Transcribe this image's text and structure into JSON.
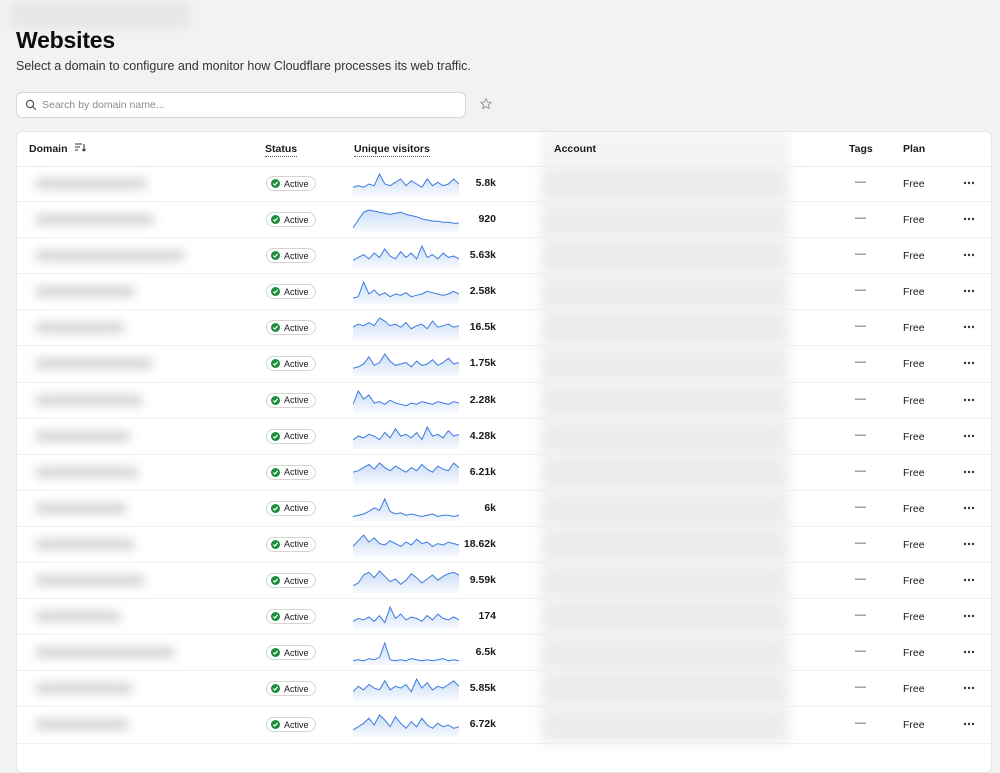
{
  "page": {
    "title": "Websites",
    "subtitle": "Select a domain to configure and monitor how Cloudflare processes its web traffic."
  },
  "search": {
    "placeholder": "Search by domain name..."
  },
  "colors": {
    "accent": "#3b7be0",
    "spark_fill": "#c9dbf5",
    "status_green": "#1a8f3a"
  },
  "table": {
    "headers": {
      "domain": "Domain",
      "status": "Status",
      "visitors": "Unique visitors",
      "account": "Account",
      "tags": "Tags",
      "plan": "Plan"
    },
    "rows": [
      {
        "status": "Active",
        "visitors": "5.8k",
        "tags": "—",
        "plan": "Free",
        "spark": [
          4,
          5,
          4,
          6,
          5,
          12,
          6,
          5,
          7,
          9,
          5,
          8,
          6,
          4,
          9,
          5,
          7,
          5,
          6,
          9,
          6
        ]
      },
      {
        "status": "Active",
        "visitors": "920",
        "tags": "—",
        "plan": "Free",
        "spark": [
          2,
          9,
          16,
          18,
          17,
          16,
          15,
          14,
          15,
          16,
          14,
          13,
          12,
          10,
          9,
          8,
          8,
          7,
          7,
          6,
          6
        ]
      },
      {
        "status": "Active",
        "visitors": "5.63k",
        "tags": "—",
        "plan": "Free",
        "spark": [
          4,
          6,
          8,
          5,
          9,
          6,
          12,
          7,
          5,
          10,
          6,
          9,
          5,
          14,
          6,
          8,
          5,
          9,
          6,
          7,
          5
        ]
      },
      {
        "status": "Active",
        "visitors": "2.58k",
        "tags": "—",
        "plan": "Free",
        "spark": [
          3,
          4,
          15,
          6,
          9,
          5,
          7,
          4,
          6,
          5,
          7,
          4,
          5,
          6,
          8,
          7,
          6,
          5,
          6,
          8,
          6
        ]
      },
      {
        "status": "Active",
        "visitors": "16.5k",
        "tags": "—",
        "plan": "Free",
        "spark": [
          7,
          9,
          8,
          10,
          8,
          13,
          11,
          8,
          9,
          7,
          10,
          6,
          8,
          9,
          6,
          11,
          7,
          8,
          9,
          7,
          8
        ]
      },
      {
        "status": "Active",
        "visitors": "1.75k",
        "tags": "—",
        "plan": "Free",
        "spark": [
          4,
          5,
          7,
          12,
          6,
          8,
          14,
          9,
          6,
          7,
          8,
          5,
          9,
          6,
          7,
          10,
          6,
          8,
          11,
          7,
          8
        ]
      },
      {
        "status": "Active",
        "visitors": "2.28k",
        "tags": "—",
        "plan": "Free",
        "spark": [
          5,
          15,
          9,
          12,
          6,
          7,
          5,
          8,
          6,
          5,
          4,
          6,
          5,
          7,
          6,
          5,
          7,
          6,
          5,
          7,
          6
        ]
      },
      {
        "status": "Active",
        "visitors": "4.28k",
        "tags": "—",
        "plan": "Free",
        "spark": [
          4,
          6,
          5,
          7,
          6,
          4,
          8,
          5,
          10,
          6,
          7,
          5,
          8,
          4,
          11,
          6,
          7,
          5,
          9,
          6,
          7
        ]
      },
      {
        "status": "Active",
        "visitors": "6.21k",
        "tags": "—",
        "plan": "Free",
        "spark": [
          7,
          8,
          10,
          12,
          9,
          13,
          10,
          8,
          11,
          9,
          7,
          10,
          8,
          12,
          9,
          7,
          11,
          9,
          8,
          13,
          10
        ]
      },
      {
        "status": "Active",
        "visitors": "6k",
        "tags": "—",
        "plan": "Free",
        "spark": [
          2,
          3,
          4,
          6,
          9,
          7,
          16,
          6,
          4,
          5,
          3,
          4,
          3,
          2,
          3,
          4,
          2,
          3,
          3,
          2,
          3
        ]
      },
      {
        "status": "Active",
        "visitors": "18.62k",
        "tags": "—",
        "plan": "Free",
        "spark": [
          6,
          10,
          14,
          9,
          12,
          8,
          7,
          10,
          8,
          6,
          9,
          7,
          11,
          8,
          9,
          6,
          8,
          7,
          9,
          8,
          7
        ]
      },
      {
        "status": "Active",
        "visitors": "9.59k",
        "tags": "—",
        "plan": "Free",
        "spark": [
          4,
          6,
          12,
          14,
          10,
          15,
          11,
          7,
          9,
          5,
          8,
          13,
          10,
          6,
          9,
          12,
          8,
          11,
          13,
          14,
          12
        ]
      },
      {
        "status": "Active",
        "visitors": "174",
        "tags": "—",
        "plan": "Free",
        "spark": [
          4,
          6,
          5,
          7,
          4,
          8,
          3,
          14,
          6,
          9,
          5,
          7,
          6,
          4,
          8,
          5,
          9,
          6,
          5,
          7,
          5
        ]
      },
      {
        "status": "Active",
        "visitors": "6.5k",
        "tags": "—",
        "plan": "Free",
        "spark": [
          2,
          3,
          2,
          4,
          3,
          5,
          18,
          3,
          2,
          3,
          2,
          4,
          3,
          2,
          3,
          2,
          3,
          4,
          2,
          3,
          2
        ]
      },
      {
        "status": "Active",
        "visitors": "5.85k",
        "tags": "—",
        "plan": "Free",
        "spark": [
          4,
          7,
          5,
          8,
          6,
          5,
          10,
          5,
          7,
          6,
          8,
          4,
          11,
          6,
          9,
          5,
          7,
          6,
          8,
          10,
          7
        ]
      },
      {
        "status": "Active",
        "visitors": "6.72k",
        "tags": "—",
        "plan": "Free",
        "spark": [
          3,
          5,
          7,
          10,
          6,
          12,
          9,
          5,
          11,
          7,
          4,
          8,
          5,
          10,
          6,
          4,
          7,
          5,
          6,
          4,
          5
        ]
      }
    ]
  }
}
